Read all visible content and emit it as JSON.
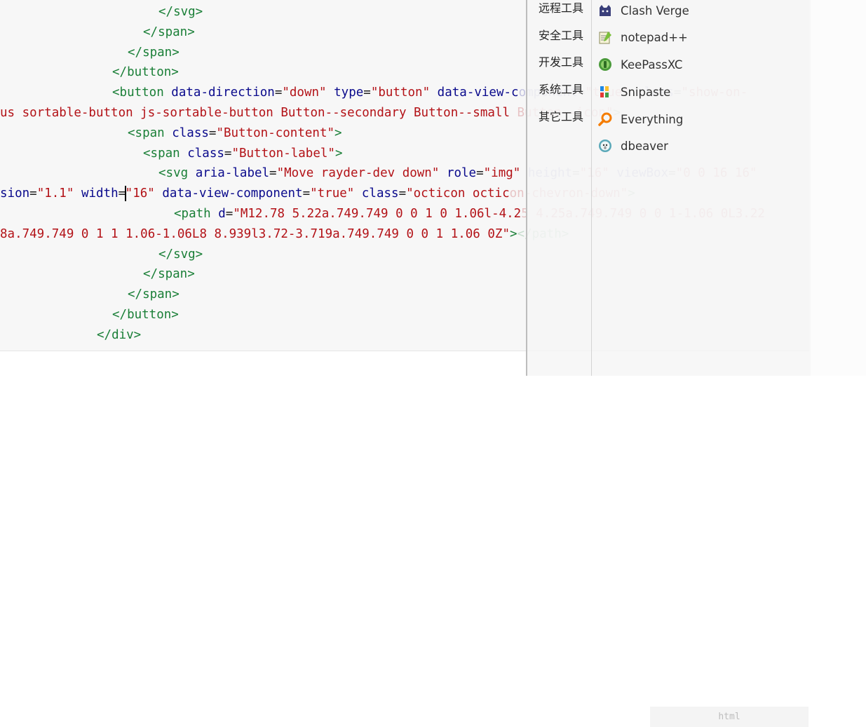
{
  "editor": {
    "lines": [
      [
        {
          "t": "tag",
          "v": "</svg>"
        }
      ],
      [
        {
          "t": "tag",
          "v": "</span>"
        }
      ],
      [
        {
          "t": "tag",
          "v": "</span>"
        }
      ],
      [
        {
          "t": "tag",
          "v": "</button>"
        }
      ],
      [
        {
          "t": "tag",
          "v": "<button "
        },
        {
          "t": "attr",
          "v": "data-direction"
        },
        {
          "t": "plain",
          "v": "="
        },
        {
          "t": "str",
          "v": "\"down\""
        },
        {
          "t": "plain",
          "v": " "
        },
        {
          "t": "attr",
          "v": "type"
        },
        {
          "t": "plain",
          "v": "="
        },
        {
          "t": "str",
          "v": "\"button\""
        },
        {
          "t": "plain",
          "v": " "
        },
        {
          "t": "attr",
          "v": "data-view-c"
        },
        {
          "t": "fattr",
          "v": "omponent"
        },
        {
          "t": "fplain",
          "v": "="
        },
        {
          "t": "fstr",
          "v": "\"true\""
        },
        {
          "t": "fplain",
          "v": " "
        },
        {
          "t": "fattr",
          "v": "class"
        },
        {
          "t": "fplain",
          "v": "="
        },
        {
          "t": "fstr",
          "v": "\"show-on-"
        }
      ],
      [
        {
          "t": "str",
          "v": "us sortable-button js-sortable-button Button--secondary Button--small "
        },
        {
          "t": "fstr",
          "v": "Button--icon\""
        },
        {
          "t": "ftag",
          "v": ">"
        }
      ],
      [
        {
          "t": "tag",
          "v": "<span "
        },
        {
          "t": "attr",
          "v": "class"
        },
        {
          "t": "plain",
          "v": "="
        },
        {
          "t": "str",
          "v": "\"Button-content\""
        },
        {
          "t": "tag",
          "v": ">"
        }
      ],
      [
        {
          "t": "tag",
          "v": "<span "
        },
        {
          "t": "attr",
          "v": "class"
        },
        {
          "t": "plain",
          "v": "="
        },
        {
          "t": "str",
          "v": "\"Button-label\""
        },
        {
          "t": "tag",
          "v": ">"
        }
      ],
      [
        {
          "t": "tag",
          "v": "<svg "
        },
        {
          "t": "attr",
          "v": "aria-label"
        },
        {
          "t": "plain",
          "v": "="
        },
        {
          "t": "str",
          "v": "\"Move rayder-dev down\""
        },
        {
          "t": "plain",
          "v": " "
        },
        {
          "t": "attr",
          "v": "role"
        },
        {
          "t": "plain",
          "v": "="
        },
        {
          "t": "str",
          "v": "\"img\""
        },
        {
          "t": "fplain",
          "v": " "
        },
        {
          "t": "fattr",
          "v": "height"
        },
        {
          "t": "fplain",
          "v": "="
        },
        {
          "t": "fstr",
          "v": "\"16\""
        },
        {
          "t": "fplain",
          "v": " "
        },
        {
          "t": "fattr",
          "v": "viewBox"
        },
        {
          "t": "fplain",
          "v": "="
        },
        {
          "t": "fstr",
          "v": "\"0 0 16 16\""
        }
      ],
      [
        {
          "t": "attr",
          "v": "sion"
        },
        {
          "t": "plain",
          "v": "="
        },
        {
          "t": "str",
          "v": "\"1.1\""
        },
        {
          "t": "plain",
          "v": " "
        },
        {
          "t": "attr",
          "v": "width"
        },
        {
          "t": "plain",
          "v": "="
        },
        {
          "t": "caret",
          "v": ""
        },
        {
          "t": "str",
          "v": "\"16\""
        },
        {
          "t": "plain",
          "v": " "
        },
        {
          "t": "attr",
          "v": "data-view-component"
        },
        {
          "t": "plain",
          "v": "="
        },
        {
          "t": "str",
          "v": "\"true\""
        },
        {
          "t": "plain",
          "v": " "
        },
        {
          "t": "attr",
          "v": "class"
        },
        {
          "t": "plain",
          "v": "="
        },
        {
          "t": "str",
          "v": "\"octicon octic"
        },
        {
          "t": "fstr",
          "v": "on-chevron-down\""
        },
        {
          "t": "ftag",
          "v": ">"
        }
      ],
      [
        {
          "t": "tag",
          "v": "<path "
        },
        {
          "t": "attr",
          "v": "d"
        },
        {
          "t": "plain",
          "v": "="
        },
        {
          "t": "str",
          "v": "\"M12.78 5.22a.749.749 0 0 1 0 1.06l-4.2"
        },
        {
          "t": "fstr",
          "v": "5 4.25a.749.749 0 0 1-1.06 0L3.22"
        }
      ],
      [
        {
          "t": "str",
          "v": "8a.749.749 0 1 1 1.06-1.06L8 8.939l3.72-3.719a.749.749 0 0 1 1.06 0Z\""
        },
        {
          "t": "tag",
          "v": ">"
        },
        {
          "t": "ftag",
          "v": "</path>"
        }
      ],
      [
        {
          "t": "tag",
          "v": "</svg>"
        }
      ],
      [
        {
          "t": "tag",
          "v": "</span>"
        }
      ],
      [
        {
          "t": "tag",
          "v": "</span>"
        }
      ],
      [
        {
          "t": "tag",
          "v": "</button>"
        }
      ],
      [
        {
          "t": "tag",
          "v": "</div>"
        }
      ]
    ],
    "status_language": "html"
  },
  "menu": {
    "categories": [
      "远程工具",
      "安全工具",
      "开发工具",
      "系统工具",
      "其它工具"
    ],
    "apps": [
      {
        "label": "Clash Verge",
        "icon": "cat-icon"
      },
      {
        "label": "notepad++",
        "icon": "notepad-icon"
      },
      {
        "label": "KeePassXC",
        "icon": "keepass-icon"
      },
      {
        "label": "Snipaste",
        "icon": "snipaste-icon"
      },
      {
        "label": "Everything",
        "icon": "magnifier-icon"
      },
      {
        "label": "dbeaver",
        "icon": "beaver-icon"
      }
    ]
  },
  "colors": {
    "tag": "#1a7f37",
    "attr": "#0a0a8c",
    "string": "#b31217",
    "editor_bg": "#f7f7f7"
  }
}
